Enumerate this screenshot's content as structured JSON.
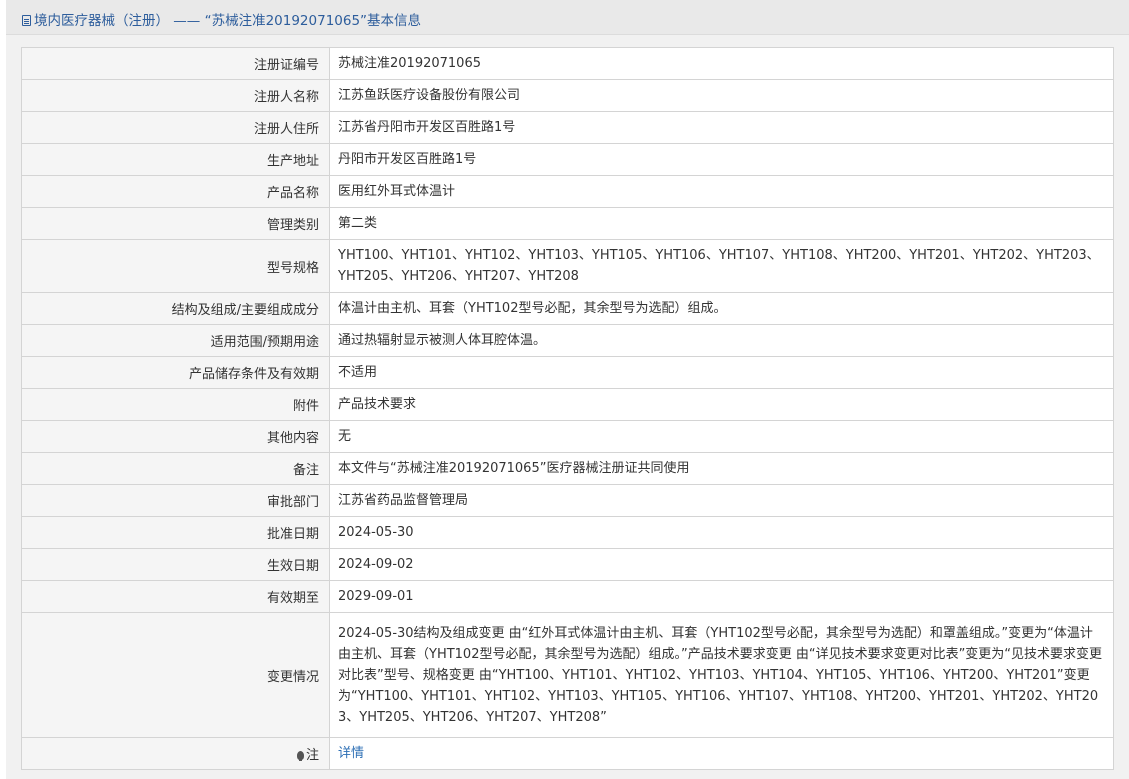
{
  "header": {
    "title": "境内医疗器械（注册） —— “苏械注准20192071065”基本信息",
    "icon": "document-icon"
  },
  "rows": [
    {
      "label": "注册证编号",
      "value": "苏械注准20192071065"
    },
    {
      "label": "注册人名称",
      "value": "江苏鱼跃医疗设备股份有限公司"
    },
    {
      "label": "注册人住所",
      "value": "江苏省丹阳市开发区百胜路1号"
    },
    {
      "label": "生产地址",
      "value": "丹阳市开发区百胜路1号"
    },
    {
      "label": "产品名称",
      "value": "医用红外耳式体温计"
    },
    {
      "label": "管理类别",
      "value": "第二类"
    },
    {
      "label": "型号规格",
      "value": "YHT100、YHT101、YHT102、YHT103、YHT105、YHT106、YHT107、YHT108、YHT200、YHT201、YHT202、YHT203、YHT205、YHT206、YHT207、YHT208"
    },
    {
      "label": "结构及组成/主要组成成分",
      "value": "体温计由主机、耳套（YHT102型号必配，其余型号为选配）组成。"
    },
    {
      "label": "适用范围/预期用途",
      "value": "通过热辐射显示被测人体耳腔体温。"
    },
    {
      "label": "产品储存条件及有效期",
      "value": "不适用"
    },
    {
      "label": "附件",
      "value": "产品技术要求"
    },
    {
      "label": "其他内容",
      "value": "无"
    },
    {
      "label": "备注",
      "value": "本文件与“苏械注准20192071065”医疗器械注册证共同使用"
    },
    {
      "label": "审批部门",
      "value": "江苏省药品监督管理局"
    },
    {
      "label": "批准日期",
      "value": "2024-05-30"
    },
    {
      "label": "生效日期",
      "value": "2024-09-02"
    },
    {
      "label": "有效期至",
      "value": "2029-09-01"
    },
    {
      "label": "变更情况",
      "value": "2024-05-30结构及组成变更 由“红外耳式体温计由主机、耳套（YHT102型号必配，其余型号为选配）和罩盖组成。”变更为“体温计由主机、耳套（YHT102型号必配，其余型号为选配）组成。”产品技术要求变更 由“详见技术要求变更对比表”变更为“见技术要求变更对比表”型号、规格变更 由“YHT100、YHT101、YHT102、YHT103、YHT104、YHT105、YHT106、YHT200、YHT201”变更为“YHT100、YHT101、YHT102、YHT103、YHT105、YHT106、YHT107、YHT108、YHT200、YHT201、YHT202、YHT203、YHT205、YHT206、YHT207、YHT208”"
    }
  ],
  "note": {
    "label": "注",
    "link": "详情",
    "icon": "lightbulb-icon"
  },
  "colors": {
    "link": "#2d6fb5",
    "title": "#2d5d9c",
    "label_bg": "#f5f5f5",
    "border": "#d4d4d4"
  }
}
